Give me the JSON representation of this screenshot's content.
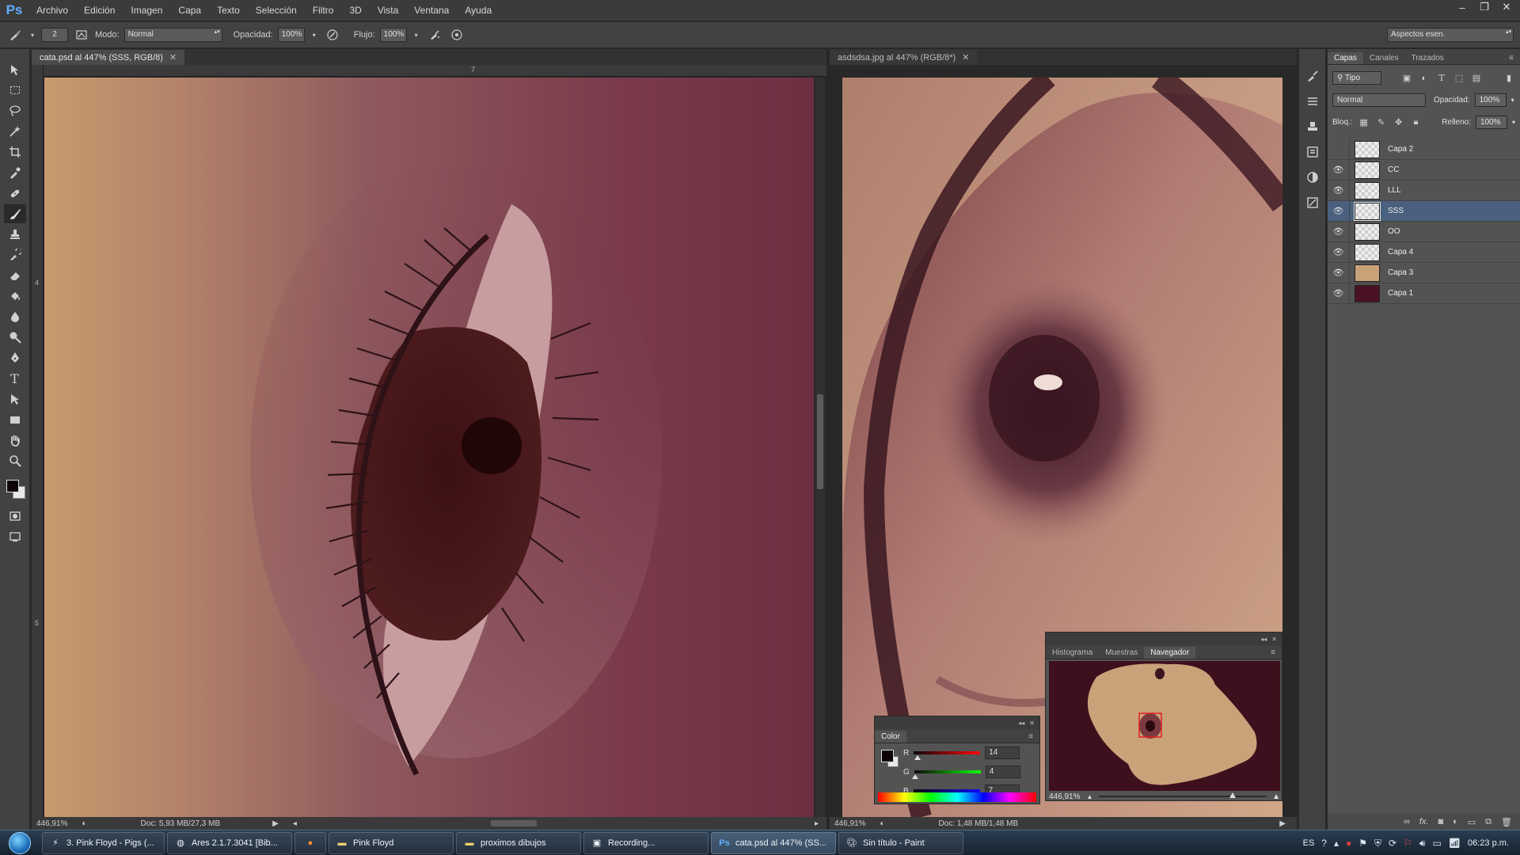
{
  "app": {
    "logo": "Ps",
    "menu": [
      "Archivo",
      "Edición",
      "Imagen",
      "Capa",
      "Texto",
      "Selección",
      "Filtro",
      "3D",
      "Vista",
      "Ventana",
      "Ayuda"
    ],
    "window_controls": [
      "–",
      "❐",
      "✕"
    ]
  },
  "options": {
    "brush_size": "2",
    "mode_label": "Modo:",
    "mode_value": "Normal",
    "opacity_label": "Opacidad:",
    "opacity_value": "100%",
    "flow_label": "Flujo:",
    "flow_value": "100%",
    "workspace": "Aspectos esen."
  },
  "documents": {
    "left": {
      "tab": "cata.psd al 447% (SSS, RGB/8)",
      "ruler_h_mark": "7",
      "ruler_v_marks": [
        "4",
        "5"
      ],
      "zoom": "446,91%",
      "doc_size": "Doc: 5,93 MB/27,3 MB"
    },
    "right": {
      "tab": "asdsdsa.jpg al 447% (RGB/8*)",
      "zoom": "446,91%",
      "doc_size": "Doc: 1,48 MB/1,48 MB"
    }
  },
  "navigator": {
    "tabs": [
      "Histograma",
      "Muestras",
      "Navegador"
    ],
    "active_tab": "Navegador",
    "zoom": "446,91%"
  },
  "color_panel": {
    "title": "Color",
    "r_label": "R",
    "r": "14",
    "g_label": "G",
    "g": "4",
    "b_label": "B",
    "b": "7",
    "r_fraction": 0.055,
    "g_fraction": 0.016,
    "b_fraction": 0.027
  },
  "layers_panel": {
    "tabs": [
      "Capas",
      "Canales",
      "Trazados"
    ],
    "filter": "Tipo",
    "blend_mode": "Normal",
    "opacity_label": "Opacidad:",
    "opacity": "100%",
    "lock_label": "Bloq.:",
    "fill_label": "Relleno:",
    "fill": "100%",
    "layers": [
      {
        "name": "Capa 2",
        "visible": false,
        "thumb": "transparent"
      },
      {
        "name": "CC",
        "visible": true,
        "thumb": "transparent"
      },
      {
        "name": "LLL",
        "visible": true,
        "thumb": "transparent"
      },
      {
        "name": "SSS",
        "visible": true,
        "thumb": "transparent",
        "selected": true
      },
      {
        "name": "OO",
        "visible": true,
        "thumb": "transparent"
      },
      {
        "name": "Capa 4",
        "visible": true,
        "thumb": "transparent"
      },
      {
        "name": "Capa 3",
        "visible": true,
        "thumb": "#c9a27a"
      },
      {
        "name": "Capa 1",
        "visible": true,
        "thumb": "#4a1024"
      }
    ]
  },
  "taskbar": {
    "items": [
      {
        "label": "3. Pink Floyd - Pigs (...",
        "icon": "media-icon"
      },
      {
        "label": "Ares 2.1.7.3041   [Bib...",
        "icon": "ares-icon"
      },
      {
        "label": "",
        "icon": "firefox-icon"
      },
      {
        "label": "Pink Floyd",
        "icon": "folder-icon"
      },
      {
        "label": "proximos dibujos",
        "icon": "folder-icon"
      },
      {
        "label": "Recording...",
        "icon": "recorder-icon"
      },
      {
        "label": "cata.psd al 447% (SS...",
        "icon": "photoshop-icon",
        "active": true
      },
      {
        "label": "Sin título - Paint",
        "icon": "paint-icon"
      }
    ],
    "lang": "ES",
    "clock": "06:23 p.m."
  }
}
